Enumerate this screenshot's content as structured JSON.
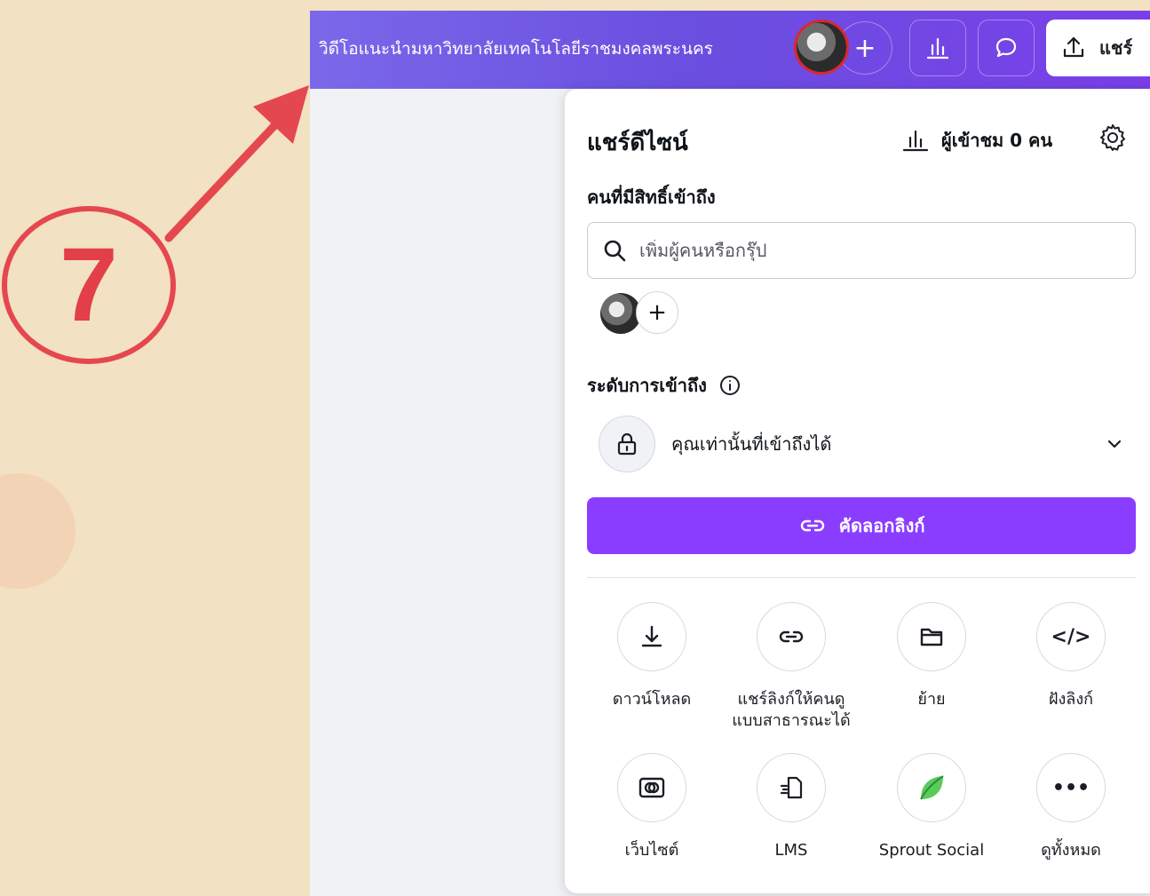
{
  "annotation": {
    "step_number": "7",
    "accent_color": "#e5474f"
  },
  "topbar": {
    "doc_title": "วิดีโอแนะนำมหาวิทยาลัยเทคโนโลยีราชมงคลพระนคร",
    "add_symbol": "+",
    "share_label": "แชร์",
    "gradient": [
      "#7b68e9",
      "#7a3fe8"
    ]
  },
  "panel": {
    "title": "แชร์ดีไซน์",
    "viewers_label": "ผู้เข้าชม 0 คน",
    "people_section_label": "คนที่มีสิทธิ์เข้าถึง",
    "search_placeholder": "เพิ่มผู้คนหรือกรุ๊ป",
    "add_symbol": "+",
    "access_level_label": "ระดับการเข้าถึง",
    "access_value": "คุณเท่านั้นที่เข้าถึงได้",
    "copy_link_label": "คัดลอกลิงก์",
    "accent_color": "#8b3dff",
    "options": [
      {
        "label": "ดาวน์โหลด",
        "icon": "download-icon"
      },
      {
        "label": "แชร์ลิงก์ให้คนดูแบบสาธารณะได้",
        "icon": "link-icon"
      },
      {
        "label": "ย้าย",
        "icon": "folder-icon"
      },
      {
        "label": "ฝังลิงก์",
        "icon": "embed-icon",
        "glyph": "</>"
      },
      {
        "label": "เว็บไซต์",
        "icon": "website-icon"
      },
      {
        "label": "LMS",
        "icon": "lms-icon"
      },
      {
        "label": "Sprout Social",
        "icon": "sprout-social-icon"
      },
      {
        "label": "ดูทั้งหมด",
        "icon": "more-icon",
        "glyph": "•••"
      }
    ]
  }
}
